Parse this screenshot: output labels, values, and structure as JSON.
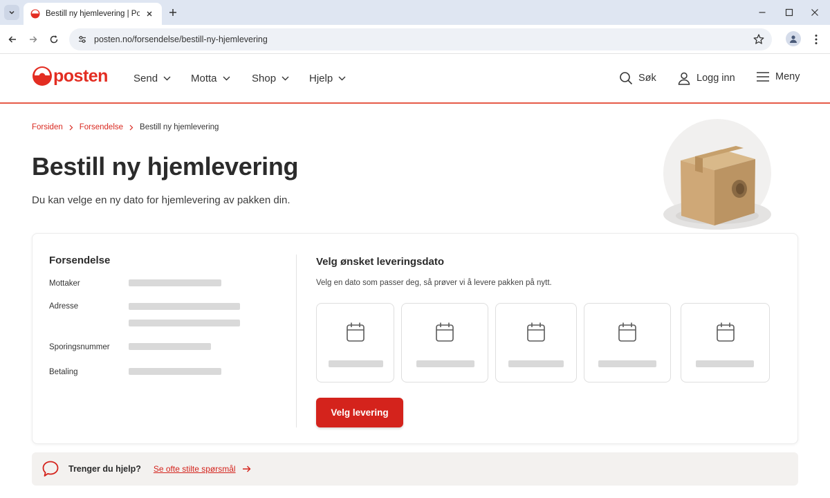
{
  "browser": {
    "tab_title": "Bestill ny hjemlevering | Posten.no",
    "url": "posten.no/forsendelse/bestill-ny-hjemlevering"
  },
  "header": {
    "logo_text": "posten",
    "nav": [
      {
        "label": "Send"
      },
      {
        "label": "Motta"
      },
      {
        "label": "Shop"
      },
      {
        "label": "Hjelp"
      }
    ],
    "search_label": "Søk",
    "login_label": "Logg inn",
    "menu_label": "Meny"
  },
  "breadcrumb": {
    "items": [
      "Forsiden",
      "Forsendelse"
    ],
    "current": "Bestill ny hjemlevering"
  },
  "page": {
    "title": "Bestill ny hjemlevering",
    "subtitle": "Du kan velge en ny dato for hjemlevering av pakken din."
  },
  "shipment": {
    "title": "Forsendelse",
    "fields": [
      {
        "label": "Mottaker"
      },
      {
        "label": "Adresse"
      },
      {
        "label": "Sporingsnummer"
      },
      {
        "label": "Betaling"
      }
    ]
  },
  "delivery": {
    "title": "Velg ønsket leveringsdato",
    "description": "Velg en dato som passer deg, så prøver vi å levere pakken på nytt.",
    "date_option_count": 5,
    "button_label": "Velg levering"
  },
  "help": {
    "question": "Trenger du hjelp?",
    "link_text": "Se ofte stilte spørsmål"
  },
  "colors": {
    "brand_red": "#e32d22",
    "button_red": "#d4231c",
    "header_border": "#e65a47",
    "skeleton": "#d9d9d9"
  },
  "icons": [
    "chevron-down-icon",
    "close-icon",
    "plus-icon",
    "back-icon",
    "forward-icon",
    "reload-icon",
    "site-settings-icon",
    "star-icon",
    "profile-icon",
    "kebab-icon",
    "search-icon",
    "user-icon",
    "hamburger-icon",
    "calendar-icon",
    "chat-bubble-icon",
    "arrow-right-icon"
  ]
}
